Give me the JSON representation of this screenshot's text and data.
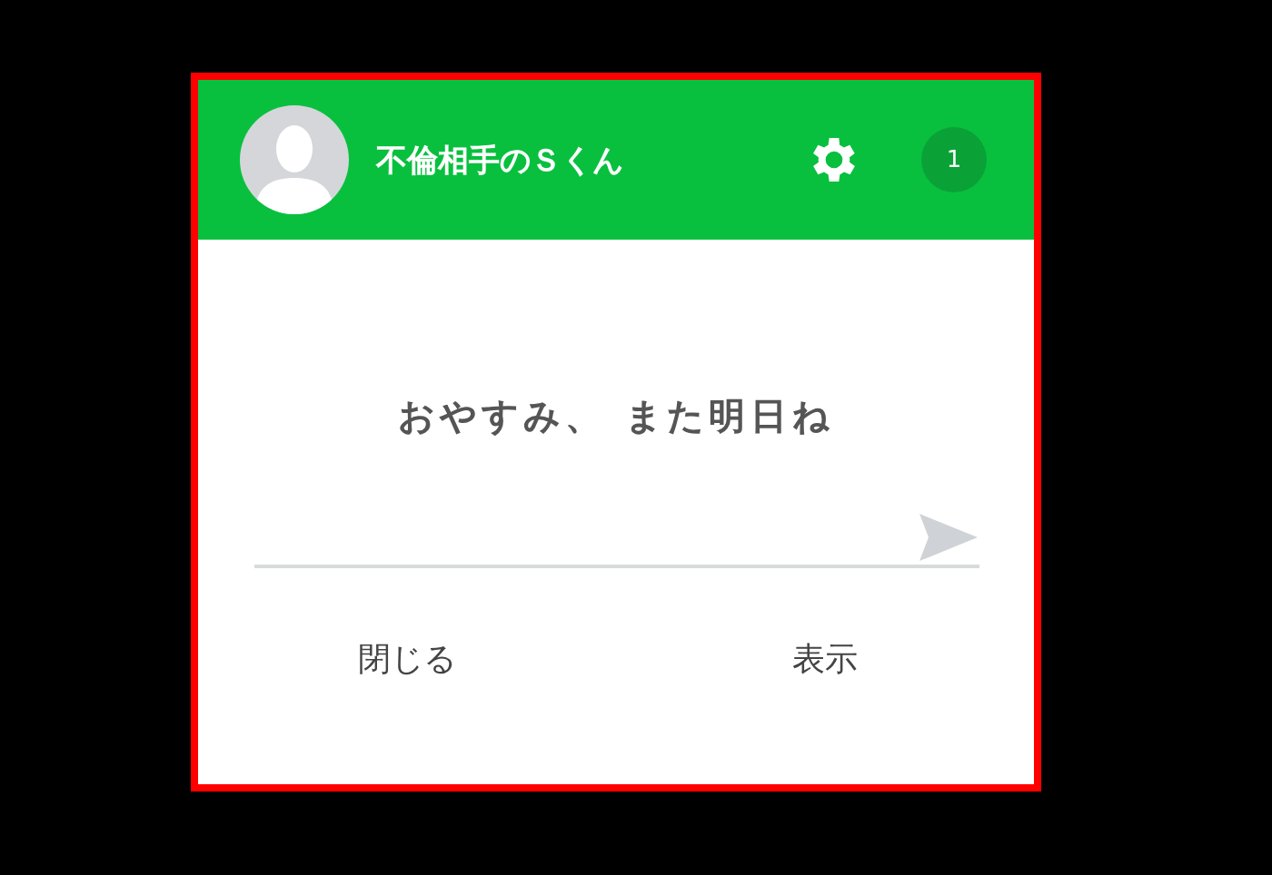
{
  "header": {
    "contact_name": "不倫相手のＳくん",
    "unread_count": "1"
  },
  "message": "おやすみ、 また明日ね",
  "buttons": [
    {
      "label": "閉じる"
    },
    {
      "label": "表示"
    }
  ]
}
